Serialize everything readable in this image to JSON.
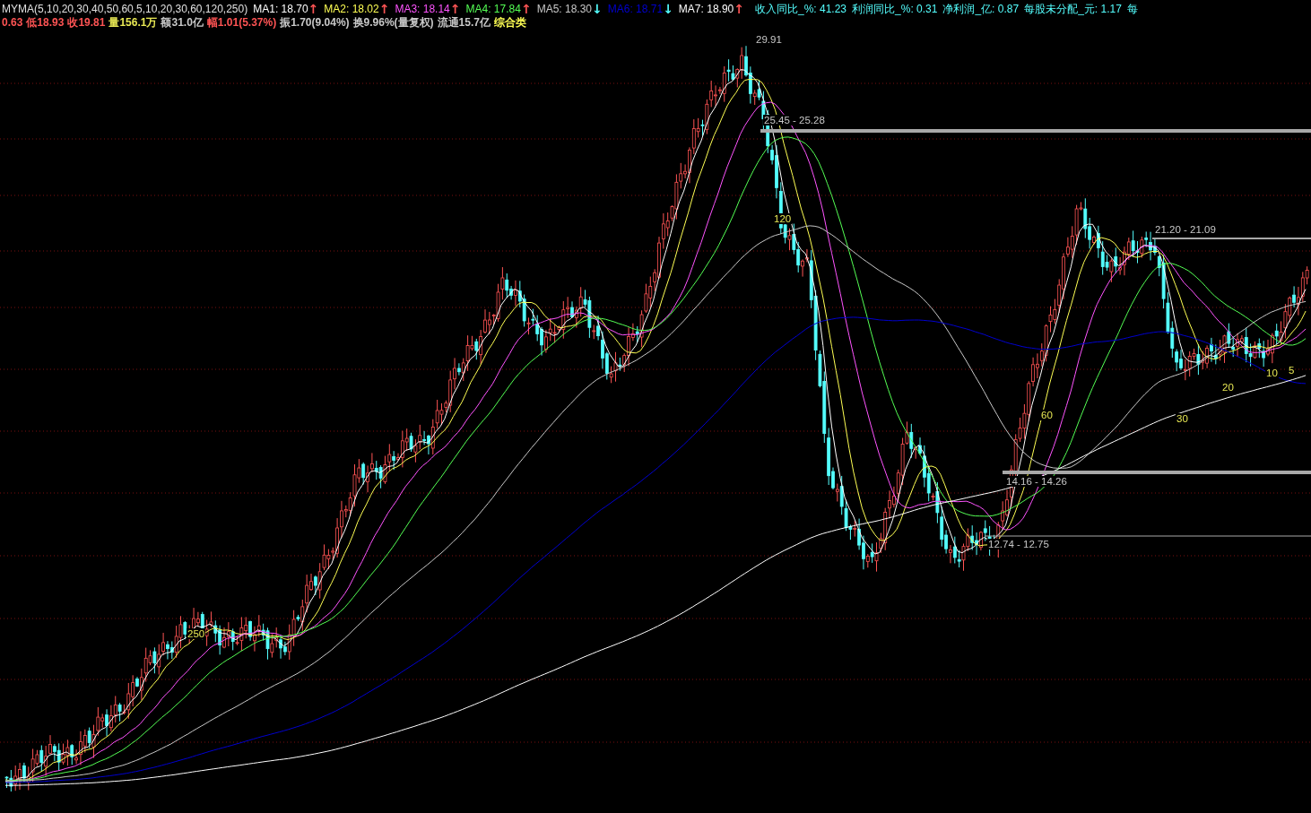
{
  "indicator": {
    "name": "MYMA(5,10,20,30,40,50,60,5,10,20,30,60,120,250)",
    "lines": [
      {
        "label": "MA1: 18.70",
        "color": "#ffffff",
        "arrow": {
          "text": "↑",
          "color": "#ff5454"
        }
      },
      {
        "label": "MA2: 18.02",
        "color": "#ffff54",
        "arrow": {
          "text": "↑",
          "color": "#ff5454"
        }
      },
      {
        "label": "MA3: 18.14",
        "color": "#ff54ff",
        "arrow": {
          "text": "↑",
          "color": "#ff5454"
        }
      },
      {
        "label": "MA4: 17.84",
        "color": "#54ff54",
        "arrow": {
          "text": "↑",
          "color": "#ff5454"
        }
      },
      {
        "label": "MA5: 18.30",
        "color": "#c8c8c8",
        "arrow": {
          "text": "↓",
          "color": "#54ffff"
        }
      },
      {
        "label": "MA6: 18.71",
        "color": "#0000d0",
        "arrow": {
          "text": "↓",
          "color": "#54ffff"
        }
      },
      {
        "label": "MA7: 18.90",
        "color": "#ffffff",
        "arrow": {
          "text": "↑",
          "color": "#ff5454"
        }
      }
    ]
  },
  "fundamentals": [
    "收入同比_%: 41.23",
    "利润同比_%: 0.31",
    "净利润_亿: 0.87",
    "每股未分配_元: 1.17",
    "每"
  ],
  "quote": [
    {
      "text": "0.63",
      "color": "#ff5454"
    },
    {
      "text": "低18.93",
      "color": "#ff5454"
    },
    {
      "text": "收19.81",
      "color": "#ff5454"
    },
    {
      "text": "量156.1万",
      "color": "#e8e854"
    },
    {
      "text": "额31.0亿",
      "color": "#c8c8c8"
    },
    {
      "text": "幅1.01(5.37%)",
      "color": "#ff5454"
    },
    {
      "text": "振1.70(9.04%)",
      "color": "#c8c8c8"
    },
    {
      "text": "换9.96%(量复权)",
      "color": "#c8c8c8"
    },
    {
      "text": "流通15.7亿",
      "color": "#c8c8c8"
    },
    {
      "text": "综合类",
      "color": "#ffff54"
    }
  ],
  "chart_labels": [
    {
      "text": "29.91",
      "kind": "price"
    },
    {
      "text": "25.45 - 25.28",
      "kind": "price"
    },
    {
      "text": "120",
      "kind": "period"
    },
    {
      "text": "21.20 - 21.09",
      "kind": "price"
    },
    {
      "text": "14.16 - 14.26",
      "kind": "price"
    },
    {
      "text": "12.74 - 12.75",
      "kind": "price"
    },
    {
      "text": "250",
      "kind": "period"
    },
    {
      "text": "60",
      "kind": "period"
    },
    {
      "text": "30",
      "kind": "period"
    },
    {
      "text": "20",
      "kind": "period"
    },
    {
      "text": "10",
      "kind": "period"
    },
    {
      "text": "5",
      "kind": "period"
    }
  ]
}
